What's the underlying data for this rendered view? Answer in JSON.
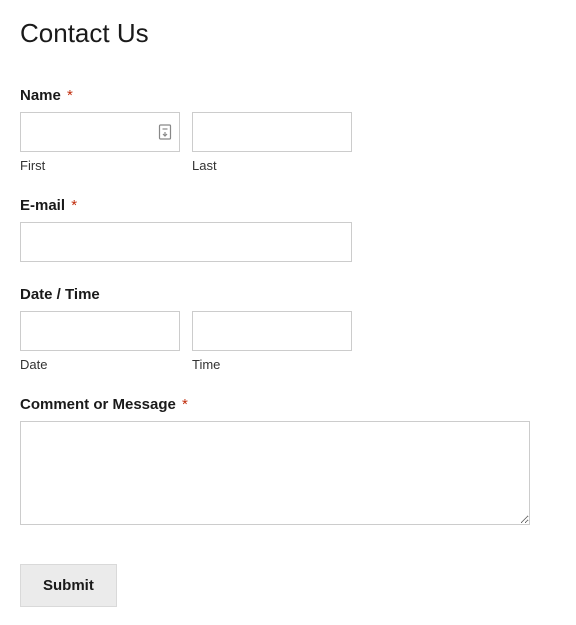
{
  "title": "Contact Us",
  "fields": {
    "name": {
      "label": "Name",
      "required": "*",
      "first": {
        "value": "",
        "sublabel": "First"
      },
      "last": {
        "value": "",
        "sublabel": "Last"
      }
    },
    "email": {
      "label": "E-mail",
      "required": "*",
      "value": ""
    },
    "datetime": {
      "label": "Date / Time",
      "date": {
        "value": "",
        "sublabel": "Date"
      },
      "time": {
        "value": "",
        "sublabel": "Time"
      }
    },
    "message": {
      "label": "Comment or Message",
      "required": "*",
      "value": ""
    }
  },
  "submit": {
    "label": "Submit"
  }
}
